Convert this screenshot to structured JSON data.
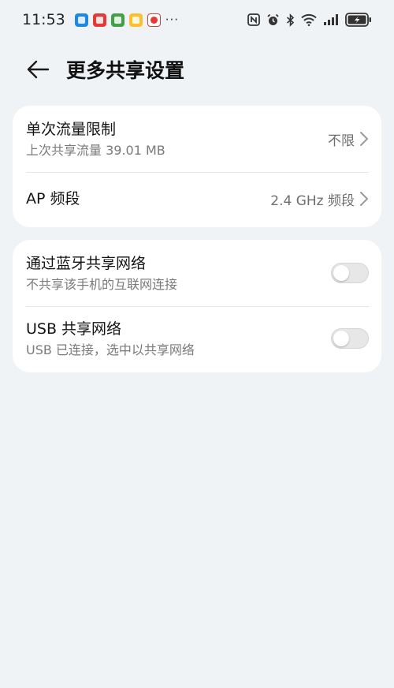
{
  "status_bar": {
    "time": "11:53",
    "more": "···",
    "app_icons": [
      "blue-app-icon",
      "red-app-icon",
      "green-app-icon",
      "yellow-app-icon",
      "white-app-icon"
    ],
    "battery_state": "charging"
  },
  "header": {
    "title": "更多共享设置"
  },
  "card1": {
    "row1": {
      "title": "单次流量限制",
      "subtitle": "上次共享流量 39.01 MB",
      "value": "不限"
    },
    "row2": {
      "title": "AP 频段",
      "value": "2.4 GHz 频段"
    }
  },
  "card2": {
    "row1": {
      "title": "通过蓝牙共享网络",
      "subtitle": "不共享该手机的互联网连接",
      "toggle_on": false
    },
    "row2": {
      "title": "USB 共享网络",
      "subtitle": "USB 已连接，选中以共享网络",
      "toggle_on": false
    }
  },
  "colors": {
    "background": "#f0f3f5",
    "card": "#ffffff",
    "toggle_off": "#e7e7e7"
  }
}
